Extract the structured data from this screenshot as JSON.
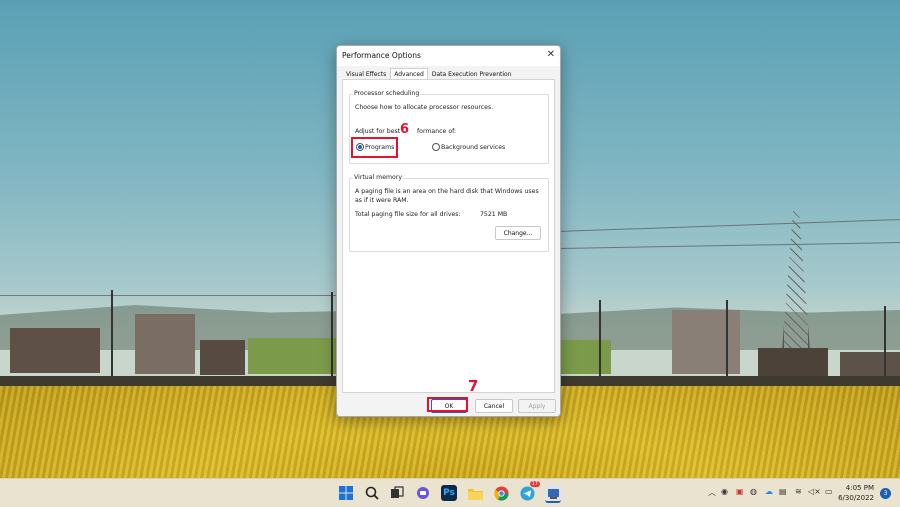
{
  "dialog": {
    "title": "Performance Options",
    "close_glyph": "✕",
    "tabs": [
      {
        "label": "Visual Effects",
        "active": false
      },
      {
        "label": "Advanced",
        "active": true
      },
      {
        "label": "Data Execution Prevention",
        "active": false
      }
    ],
    "processor": {
      "group_title": "Processor scheduling",
      "description": "Choose how to allocate processor resources.",
      "adjust_label_part1": "Adjust for best",
      "adjust_label_part2": "formance of:",
      "option_programs": "Programs",
      "option_background": "Background services",
      "selected": "Programs"
    },
    "virtual_memory": {
      "group_title": "Virtual memory",
      "desc_line1": "A paging file is an area on the hard disk that Windows uses",
      "desc_line2": "as if it were RAM.",
      "total_label": "Total paging file size for all drives:",
      "total_value": "7521 MB",
      "change_button": "Change..."
    },
    "buttons": {
      "ok": "OK",
      "cancel": "Cancel",
      "apply": "Apply"
    }
  },
  "annotations": {
    "step_6": "6",
    "step_7": "7",
    "color": "#e0142c"
  },
  "taskbar": {
    "icons": [
      "windows-start-icon",
      "search-icon",
      "task-view-icon",
      "chat-icon",
      "photoshop-icon",
      "file-explorer-icon",
      "chrome-icon",
      "telegram-icon",
      "app-icon"
    ],
    "photoshop_label": "Ps",
    "telegram_badge": "17",
    "clock_time": "4:05 PM",
    "clock_date": "6/30/2022",
    "notification_count": "3"
  }
}
